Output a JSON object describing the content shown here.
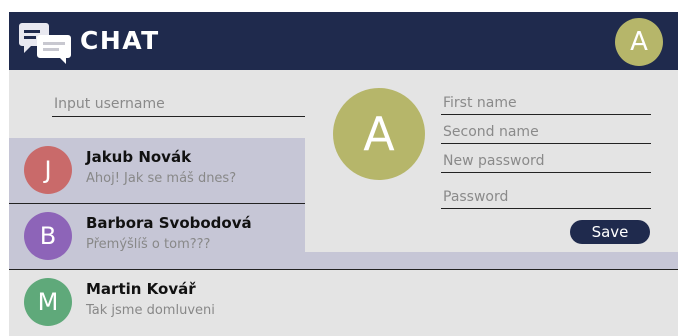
{
  "header": {
    "title": "CHAT",
    "avatar_letter": "A",
    "logo_icon": "chat-bubbles-icon"
  },
  "search": {
    "placeholder": "Input username"
  },
  "contacts": [
    {
      "initial": "J",
      "name": "Jakub Novák",
      "last_message": "Ahoj! Jak se máš dnes?",
      "color": "#c96a6a"
    },
    {
      "initial": "B",
      "name": "Barbora Svobodová",
      "last_message": "Přemýšlíš o tom???",
      "color": "#8d64b8"
    },
    {
      "initial": "M",
      "name": "Martin Kovář",
      "last_message": "Tak jsme domluveni",
      "color": "#5fa97a"
    }
  ],
  "profile_panel": {
    "avatar_letter": "A",
    "fields": {
      "first_name_placeholder": "First name",
      "second_name_placeholder": "Second name",
      "new_password_placeholder": "New password",
      "password_placeholder": "Password"
    },
    "save_label": "Save"
  },
  "colors": {
    "navy": "#1f2a4d",
    "avatar_olive": "#b6b66a",
    "background": "#e4e4e4",
    "dimmed_row": "#c6c6d6",
    "unread_dot": "#f0a5a5"
  }
}
